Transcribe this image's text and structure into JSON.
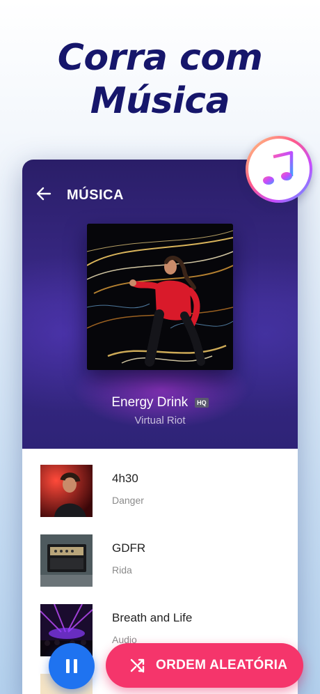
{
  "headline": {
    "line1": "Corra com",
    "line2": "Música"
  },
  "screen": {
    "title": "MÚSICA"
  },
  "now_playing": {
    "title": "Energy Drink",
    "quality_badge": "HQ",
    "artist": "Virtual Riot"
  },
  "songs": [
    {
      "title": "4h30",
      "artist": "Danger"
    },
    {
      "title": "GDFR",
      "artist": "Rida"
    },
    {
      "title": "Breath and Life",
      "artist": "Audio"
    }
  ],
  "controls": {
    "shuffle_label": "ORDEM ALEATÓRIA"
  },
  "colors": {
    "accent_pink": "#f5356b",
    "accent_blue": "#1f73f0",
    "headline": "#16166b",
    "player_bg": "#2e2377"
  },
  "icons": {
    "back": "back-arrow-icon",
    "itunes": "itunes-music-icon",
    "pause": "pause-icon",
    "shuffle": "shuffle-icon"
  }
}
